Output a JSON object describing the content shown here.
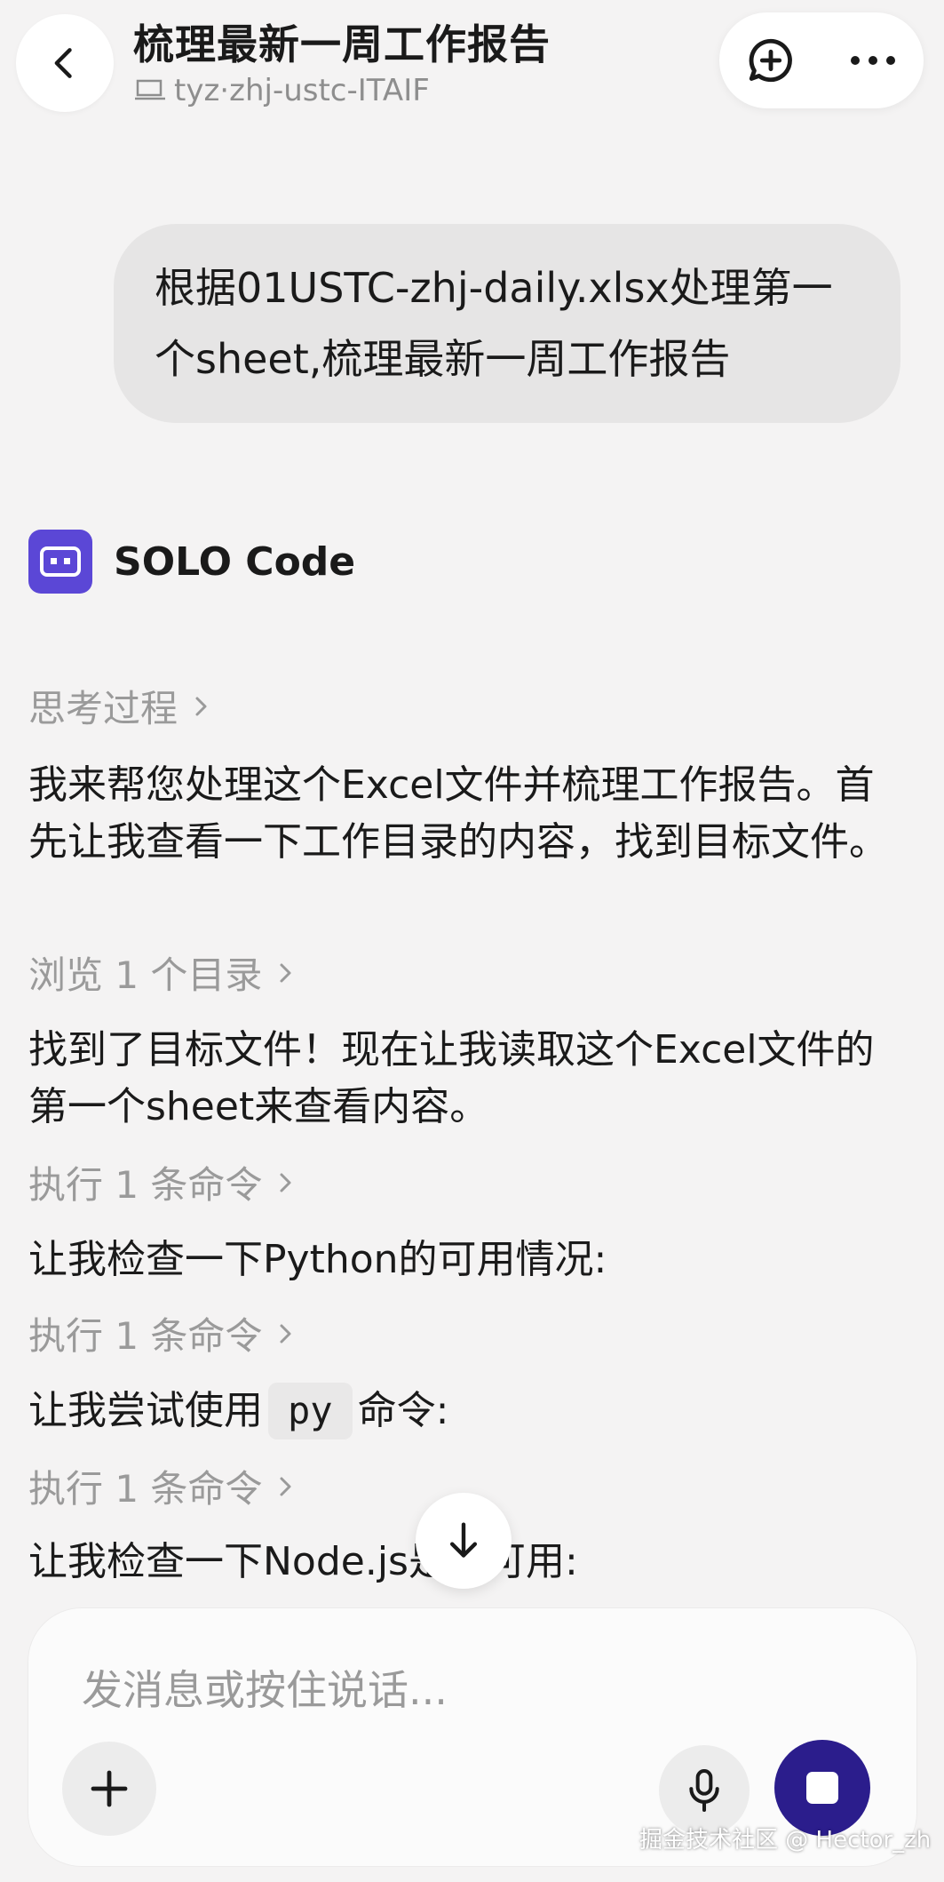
{
  "header": {
    "title": "梳理最新一周工作报告",
    "subtitle": "tyz·zhj-ustc-ITAIF"
  },
  "user_message": {
    "text": "根据01USTC-zhj-daily.xlsx处理第一个sheet,梳理最新一周工作报告"
  },
  "agent": {
    "name": "SOLO Code",
    "accent": "#5b47d6"
  },
  "conversation": {
    "thinking_label": "思考过程",
    "msg1": "我来帮您处理这个Excel文件并梳理工作报告。首先让我查看一下工作目录的内容，找到目标文件。",
    "step_browse": "浏览 1 个目录",
    "msg2": "找到了目标文件！现在让我读取这个Excel文件的第一个sheet来查看内容。",
    "step_cmd1": "执行 1 条命令",
    "msg3": "让我检查一下Python的可用情况:",
    "step_cmd2": "执行 1 条命令",
    "msg4_before": "让我尝试使用",
    "msg4_code": "py",
    "msg4_after": "命令:",
    "step_cmd3": "执行 1 条命令",
    "msg5": "让我检查一下Node.js是否可用:"
  },
  "composer": {
    "placeholder": "发消息或按住说话..."
  },
  "icons": {
    "back": "chevron-left-icon",
    "new_chat": "chat-plus-icon",
    "more": "more-dots-icon",
    "scroll_down": "arrow-down-icon",
    "add": "plus-icon",
    "mic": "microphone-icon",
    "stop": "stop-icon"
  },
  "colors": {
    "stop_button": "#2b1d8c",
    "background": "#f4f3f3"
  },
  "watermark": "掘金技术社区 @ Hector_zh"
}
